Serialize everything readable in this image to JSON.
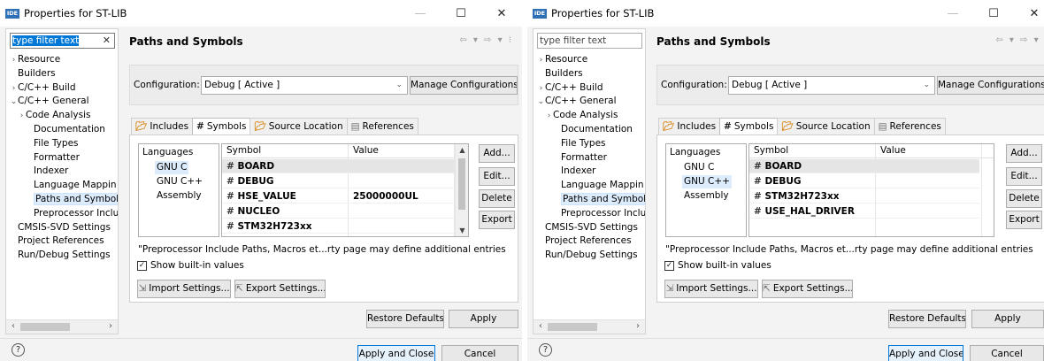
{
  "dialog1": {
    "title": "Properties for ST-LIB",
    "window": {
      "min": "—",
      "max": "☐",
      "close": "✕"
    },
    "filter": {
      "text": "type filter text",
      "clear": "✕"
    },
    "tree": [
      {
        "label": "Resource",
        "arrow": "›"
      },
      {
        "label": "Builders",
        "arrow": ""
      },
      {
        "label": "C/C++ Build",
        "arrow": "›"
      },
      {
        "label": "C/C++ General",
        "arrow": "⌄"
      },
      {
        "label": "Code Analysis",
        "arrow": "›"
      },
      {
        "label": "Documentation",
        "arrow": ""
      },
      {
        "label": "File Types",
        "arrow": ""
      },
      {
        "label": "Formatter",
        "arrow": ""
      },
      {
        "label": "Indexer",
        "arrow": ""
      },
      {
        "label": "Language Mappin",
        "arrow": ""
      },
      {
        "label": "Paths and Symbols",
        "arrow": ""
      },
      {
        "label": "Preprocessor Inclu",
        "arrow": ""
      },
      {
        "label": "CMSIS-SVD Settings",
        "arrow": ""
      },
      {
        "label": "Project References",
        "arrow": ""
      },
      {
        "label": "Run/Debug Settings",
        "arrow": ""
      }
    ],
    "panel_title": "Paths and Symbols",
    "history": "⇦ ▾ ⇨ ▾ ⁝",
    "config_label": "Configuration:",
    "config_value": "Debug  [ Active ]",
    "manage": "Manage Configurations...",
    "tabs": [
      "Includes",
      "Symbols",
      "Source Location",
      "References"
    ],
    "languages_header": "Languages",
    "languages": [
      "GNU C",
      "GNU C++",
      "Assembly"
    ],
    "symbol_header": "Symbol",
    "value_header": "Value",
    "rows": [
      {
        "symbol": "BOARD",
        "value": ""
      },
      {
        "symbol": "DEBUG",
        "value": ""
      },
      {
        "symbol": "HSE_VALUE",
        "value": "25000000UL"
      },
      {
        "symbol": "NUCLEO",
        "value": ""
      },
      {
        "symbol": "STM32H723xx",
        "value": ""
      }
    ],
    "side_buttons": [
      "Add...",
      "Edit...",
      "Delete",
      "Export"
    ],
    "note": "\"Preprocessor Include Paths, Macros et...rty page may define additional entries",
    "show_builtin": "Show built-in values",
    "import": "Import Settings...",
    "export": "Export Settings...",
    "restore": "Restore Defaults",
    "apply": "Apply",
    "apply_close": "Apply and Close",
    "cancel": "Cancel",
    "help": "?"
  },
  "dialog2": {
    "title": "Properties for ST-LIB",
    "window": {
      "min": "—",
      "max": "☐",
      "close": "✕"
    },
    "filter": {
      "text": "type filter text"
    },
    "tree": [
      {
        "label": "Resource",
        "arrow": "›"
      },
      {
        "label": "Builders",
        "arrow": ""
      },
      {
        "label": "C/C++ Build",
        "arrow": "›"
      },
      {
        "label": "C/C++ General",
        "arrow": "⌄"
      },
      {
        "label": "Code Analysis",
        "arrow": "›"
      },
      {
        "label": "Documentation",
        "arrow": ""
      },
      {
        "label": "File Types",
        "arrow": ""
      },
      {
        "label": "Formatter",
        "arrow": ""
      },
      {
        "label": "Indexer",
        "arrow": ""
      },
      {
        "label": "Language Mappin",
        "arrow": ""
      },
      {
        "label": "Paths and Symbols",
        "arrow": ""
      },
      {
        "label": "Preprocessor Inclu",
        "arrow": ""
      },
      {
        "label": "CMSIS-SVD Settings",
        "arrow": ""
      },
      {
        "label": "Project References",
        "arrow": ""
      },
      {
        "label": "Run/Debug Settings",
        "arrow": ""
      }
    ],
    "panel_title": "Paths and Symbols",
    "history": "⇦ ▾ ⇨ ▾ ⁝",
    "config_label": "Configuration:",
    "config_value": "Debug  [ Active ]",
    "manage": "Manage Configurations...",
    "tabs": [
      "Includes",
      "Symbols",
      "Source Location",
      "References"
    ],
    "languages_header": "Languages",
    "languages": [
      "GNU C",
      "GNU C++",
      "Assembly"
    ],
    "symbol_header": "Symbol",
    "value_header": "Value",
    "rows": [
      {
        "symbol": "BOARD",
        "value": ""
      },
      {
        "symbol": "DEBUG",
        "value": ""
      },
      {
        "symbol": "STM32H723xx",
        "value": ""
      },
      {
        "symbol": "USE_HAL_DRIVER",
        "value": ""
      }
    ],
    "side_buttons": [
      "Add...",
      "Edit...",
      "Delete",
      "Export"
    ],
    "note": "\"Preprocessor Include Paths, Macros et...rty page may define additional entries",
    "show_builtin": "Show built-in values",
    "import": "Import Settings...",
    "export": "Export Settings...",
    "restore": "Restore Defaults",
    "apply": "Apply",
    "apply_close": "Apply and Close",
    "cancel": "Cancel",
    "help": "?"
  }
}
